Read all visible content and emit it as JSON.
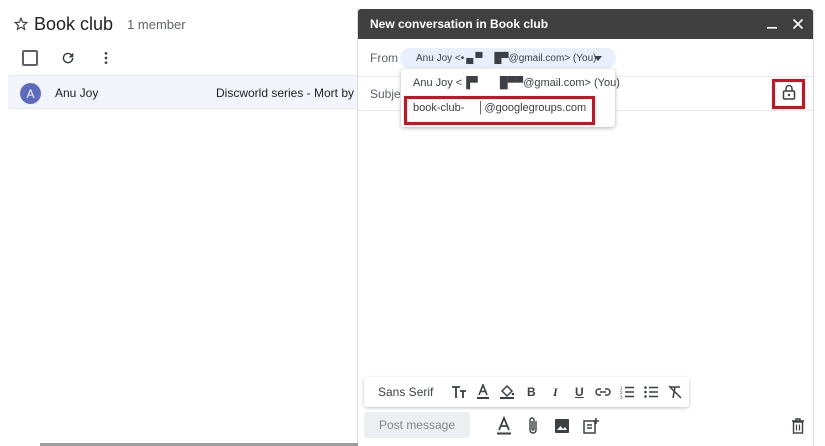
{
  "group": {
    "title": "Book club",
    "member_count": "1 member"
  },
  "thread": {
    "avatar_letter": "A",
    "sender": "Anu Joy",
    "subject": "Discworld series - Mort by Te"
  },
  "compose": {
    "title": "New conversation in Book club",
    "from_label": "From",
    "from_value": "Anu Joy <• ▄ ▀  █▀@gmail.com> (You)",
    "subject_label": "Subjec",
    "dropdown": {
      "option_personal": "Anu Joy <▐▀  █▀▀@gmail.com> (You)",
      "option_group": "book-club-  │@googlegroups.com"
    },
    "format": {
      "font": "Sans Serif"
    },
    "post_label": "Post message"
  },
  "colors": {
    "titlebar": "#404040",
    "highlight": "#d0101f",
    "avatar": "#5c6bc0",
    "chip": "#e8f0fe"
  },
  "icons": [
    "star-icon",
    "refresh-icon",
    "more-vert-icon",
    "minimize-icon",
    "close-icon",
    "caret-down-icon",
    "lock-icon",
    "text-size-icon",
    "text-color-icon",
    "fill-color-icon",
    "bold-icon",
    "italic-icon",
    "underline-icon",
    "link-icon",
    "numbered-list-icon",
    "bulleted-list-icon",
    "clear-format-icon",
    "format-options-icon",
    "attach-icon",
    "image-icon",
    "add-note-icon",
    "trash-icon"
  ]
}
